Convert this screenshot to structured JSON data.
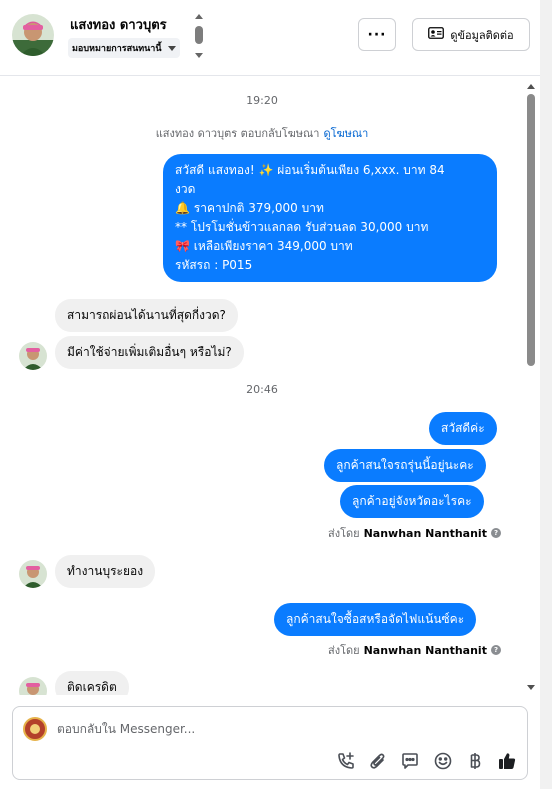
{
  "header": {
    "contact_name": "แสงทอง ดาวบุตร",
    "assign_label": "มอบหมายการสนทนานี้",
    "more_label": "···",
    "contact_info_label": "ดูข้อมูลติดต่อ"
  },
  "chat": {
    "time_1": "19:20",
    "ad_notice": "แสงทอง ดาวบุตร ตอบกลับโฆษณา",
    "ad_link": "ดูโฆษณา",
    "promo": {
      "line_1": "สวัสดี แสงทอง! ✨  ผ่อนเริ่มต้นเพียง 6,xxx. บาท 84",
      "line_2": "งวด",
      "line_3": "🔔 ราคาปกติ 379,000 บาท",
      "line_4": "** โปรโมชั่นข้าวแลกลด รับส่วนลด 30,000 บาท",
      "line_5": "🎀  เหลือเพียงราคา 349,000 บาท",
      "line_6": " รหัสรถ : P015"
    },
    "in_1": "สามารถผ่อนได้นานที่สุดกี่งวด?",
    "in_2": "มีค่าใช้จ่ายเพิ่มเติมอื่นๆ หรือไม่?",
    "time_2": "20:46",
    "out_1": "สวัสดีค่ะ",
    "out_2": "ลูกค้าสนใจรถรุ่นนี้อยู่นะคะ",
    "out_3": "ลูกค้าอยู่จังหวัดอะไรคะ",
    "sent_by_prefix": "ส่งโดย",
    "sent_by_name": "Nanwhan Nanthanit",
    "info_mark": "?",
    "in_3": "ทำงานบุระยอง",
    "out_4": "ลูกค้าสนใจซื้อสหรือจัดไฟแน้นซ์คะ",
    "in_4": "ติดเครดิต"
  },
  "composer": {
    "placeholder": "ตอบกลับใน Messenger..."
  },
  "colors": {
    "accent": "#0a7cff",
    "link": "#0064d1",
    "incoming_bubble": "#f0f0f0"
  },
  "icons": [
    "more-icon",
    "contact-card-icon",
    "call-add-icon",
    "attach-icon",
    "saved-reply-icon",
    "emoji-icon",
    "baht-icon",
    "like-icon"
  ]
}
